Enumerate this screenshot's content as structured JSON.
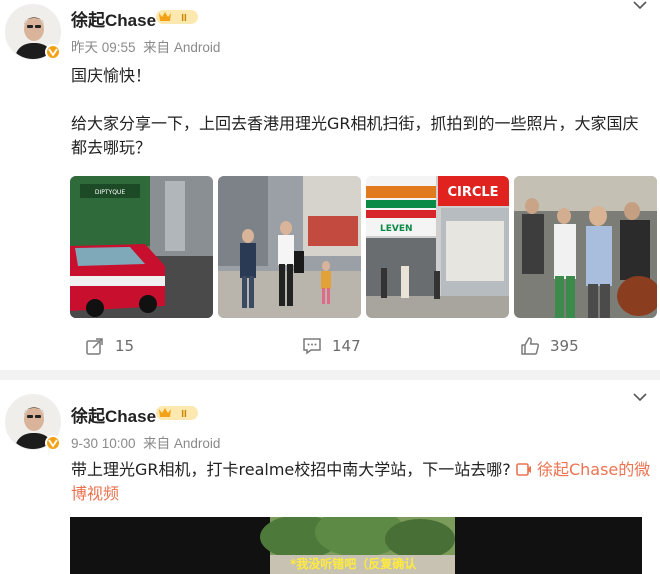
{
  "posts": [
    {
      "author": "徐起Chase",
      "level": "II",
      "time": "昨天 09:55",
      "source": "来自 Android",
      "text_line1": "国庆愉快！",
      "text_line2": "给大家分享一下，上回去香港用理光GR相机扫街，抓拍到的一些照片，大家国庆",
      "text_line3": "都去哪玩？",
      "photos": [
        {
          "icon": "photo-red-taxi",
          "sign": "DIPTYQUE"
        },
        {
          "icon": "photo-street-people"
        },
        {
          "icon": "photo-711-circle-k",
          "sign_a": "LEVEN",
          "sign_b": "CIRCLE"
        },
        {
          "icon": "photo-crowd-crossing"
        }
      ],
      "actions": {
        "share": "15",
        "comment": "147",
        "like": "395"
      }
    },
    {
      "author": "徐起Chase",
      "level": "II",
      "time": "9-30 10:00",
      "source": "来自 Android",
      "text_line1_pre": "带上理光GR相机，打卡realme校招中南大学站，下一站去哪?",
      "video_link_a": "徐起Chase的微",
      "video_link_b": "博视频",
      "video_subtitle": "*我没听错吧（反复确认"
    }
  ],
  "colors": {
    "accent": "#eb7350",
    "badge": "#f3a217",
    "meta": "#8a8a8a",
    "divider": "#f2f2f2"
  }
}
